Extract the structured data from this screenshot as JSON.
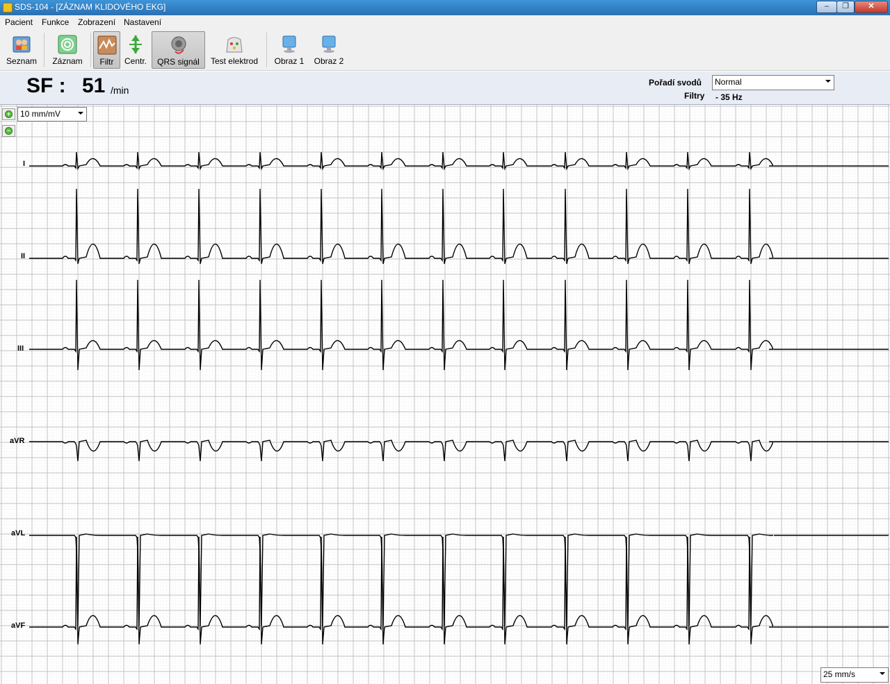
{
  "window": {
    "title": "SDS-104 - [ZÁZNAM KLIDOVÉHO EKG]",
    "minimize": "‒",
    "maximize": "❐",
    "close": "✕"
  },
  "menu": [
    "Pacient",
    "Funkce",
    "Zobrazení",
    "Nastavení"
  ],
  "toolbar": [
    {
      "label": "Seznam",
      "icon": "patient-list-icon",
      "pressed": false
    },
    {
      "label": "Záznam",
      "icon": "record-icon",
      "pressed": false
    },
    {
      "label": "Filtr",
      "icon": "filter-icon",
      "pressed": true
    },
    {
      "label": "Centr.",
      "icon": "center-icon",
      "pressed": false
    },
    {
      "label": "QRS signál",
      "icon": "qrs-signal-icon",
      "pressed": true
    },
    {
      "label": "Test elektrod",
      "icon": "electrode-test-icon",
      "pressed": false
    },
    {
      "label": "Obraz 1",
      "icon": "monitor-icon",
      "pressed": false
    },
    {
      "label": "Obraz 2",
      "icon": "monitor-icon",
      "pressed": false
    }
  ],
  "info": {
    "sf_label": "SF :",
    "heart_rate": "51",
    "heart_rate_unit": "/min",
    "lead_order_label": "Pořadí svodů",
    "lead_order_value": "Normal",
    "filters_label": "Filtry",
    "filters_value": "- 35 Hz"
  },
  "gain": "10 mm/mV",
  "speed": "25 mm/s",
  "leads": [
    "I",
    "II",
    "III",
    "aVR",
    "aVL",
    "aVF"
  ],
  "colors": {
    "grid_major": "#c0c0c0",
    "grid_minor": "#e0e0e0",
    "trace": "#000000",
    "info_bg": "#e8ecf5"
  }
}
